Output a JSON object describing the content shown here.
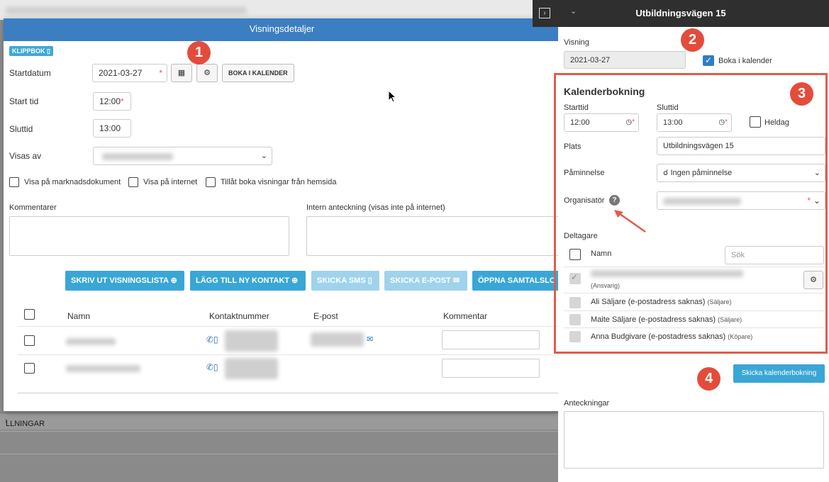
{
  "modal": {
    "title": "Visningsdetaljer",
    "klippbok": "KLIPPBOK",
    "startdatum_label": "Startdatum",
    "startdatum_value": "2021-03-27",
    "boka_button": "BOKA I KALENDER",
    "starttid_label": "Start tid",
    "starttid_value": "12:00",
    "sluttid_label": "Sluttid",
    "sluttid_value": "13:00",
    "visas_av_label": "Visas av",
    "chk_marknad": "Visa på marknadsdokument",
    "chk_internet": "Visa på internet",
    "chk_hemsida": "Tillåt boka visningar från hemsida",
    "kommentarer_label": "Kommentarer",
    "intern_label": "Intern anteckning (visas inte på internet)",
    "actions": {
      "skriv_ut": "SKRIV UT VISNINGSLISTA",
      "lagg_till": "LÄGG TILL NY KONTAKT",
      "skicka_sms": "SKICKA SMS",
      "skicka_epost": "SKICKA E-POST",
      "oppna": "ÖPPNA SAMTALSLO"
    },
    "table": {
      "col_namn": "Namn",
      "col_kontakt": "Kontaktnummer",
      "col_epost": "E-post",
      "col_kommentar": "Kommentar"
    }
  },
  "background": {
    "breadcrumb": "LLNINGAR"
  },
  "panel": {
    "title": "Utbildningsvägen 15",
    "visning_label": "Visning",
    "visning_value": "2021-03-27",
    "boka_checkbox": "Boka i kalender",
    "kalender_heading": "Kalenderbokning",
    "starttid_label": "Starttid",
    "starttid_value": "12:00",
    "sluttid_label": "Sluttid",
    "sluttid_value": "13:00",
    "heldag": "Heldag",
    "plats_label": "Plats",
    "plats_value": "Utbildningsvägen 15",
    "paminnelse_label": "Påminnelse",
    "paminnelse_value": "Ingen påminnelse",
    "organisator_label": "Organisatör",
    "deltagare_label": "Deltagare",
    "namn_header": "Namn",
    "sok_placeholder": "Sök",
    "participants": [
      {
        "name": "",
        "role": "(Ansvarig)"
      },
      {
        "name": "Ali Säljare (e-postadress saknas)",
        "role": "(Säljare)"
      },
      {
        "name": "Maite Säljare (e-postadress saknas)",
        "role": "(Säljare)"
      },
      {
        "name": "Anna Budgivare (e-postadress saknas)",
        "role": "(Köpare)"
      }
    ],
    "skicka_button": "Skicka kalenderbokning",
    "anteckningar_label": "Anteckningar"
  },
  "badges": [
    "1",
    "2",
    "3",
    "4"
  ],
  "colors": {
    "header_blue": "#3b7ec2",
    "button_blue": "#3aa6d6",
    "badge_red": "#e34c3b"
  }
}
